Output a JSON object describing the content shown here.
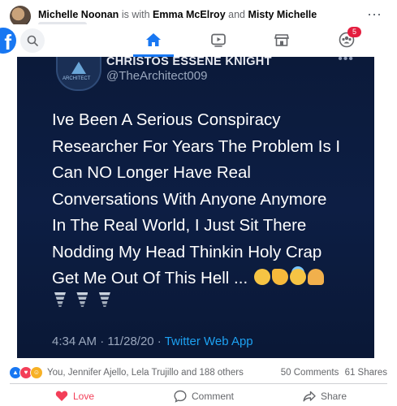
{
  "post": {
    "author": "Michelle Noonan",
    "with_text": "is with",
    "tagged_1": "Emma McElroy",
    "and_text": "and",
    "tagged_2": "Misty Michelle",
    "more_icon": "more-horizontal-icon"
  },
  "nav": {
    "logo": "f",
    "notification_count": "5",
    "tabs": [
      "home-icon",
      "video-icon",
      "marketplace-icon",
      "groups-icon"
    ],
    "accent": "#1877f2"
  },
  "tweet": {
    "name": "CHRISTOS ESSENE KNIGHT",
    "handle": "@TheArchitect009",
    "avatar_text": "ARCHITECT",
    "lines": [
      "Ive Been A Serious Conspiracy",
      "Researcher For Years The Problem Is I",
      "Can NO Longer Have Real",
      "Conversations With Anyone Anymore",
      "In The Real World, I Just Sit There",
      "Nodding My Head Thinkin Holy Crap",
      "Get Me Out Of This Hell ..."
    ],
    "timestamp": "4:34 AM · 11/28/20 · ",
    "app": "Twitter Web App",
    "background": "#0c1c40",
    "link_color": "#1da1f2"
  },
  "reactions": {
    "names": "You, Jennifer Ajello, Lela Trujillo and 188 others",
    "comments": "50 Comments",
    "shares": "61 Shares"
  },
  "actions": {
    "love": "Love",
    "comment": "Comment",
    "share": "Share",
    "love_color": "#f33e58"
  }
}
